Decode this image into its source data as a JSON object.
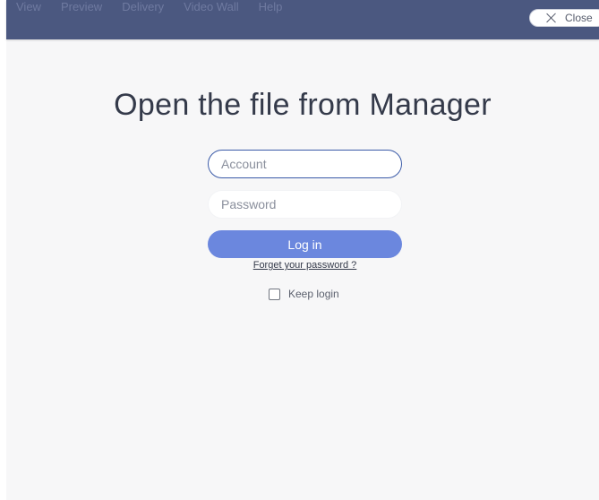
{
  "menubar": {
    "items": [
      {
        "label": "View"
      },
      {
        "label": "Preview"
      },
      {
        "label": "Delivery"
      },
      {
        "label": "Video Wall"
      },
      {
        "label": "Help"
      }
    ],
    "close_label": "Close"
  },
  "login": {
    "title": "Open the file from Manager",
    "account_placeholder": "Account",
    "password_placeholder": "Password",
    "login_label": "Log in",
    "forget_label": "Forget your password ?",
    "keep_login_label": "Keep login",
    "keep_login_checked": false
  },
  "colors": {
    "menubar_bg": "#4b5880",
    "accent_button": "#6b87de",
    "focus_border": "#3b5ba8"
  },
  "icons": [
    "close-icon",
    "checkbox-icon"
  ]
}
